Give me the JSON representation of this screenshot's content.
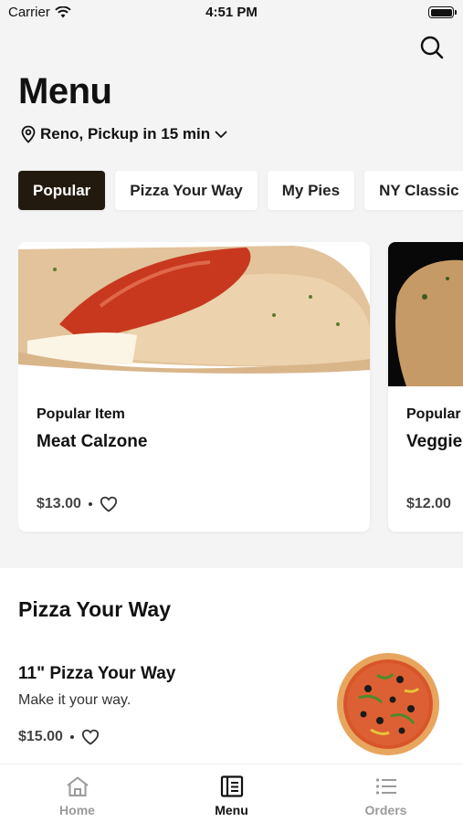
{
  "status_bar": {
    "carrier": "Carrier",
    "time": "4:51 PM"
  },
  "header": {
    "title": "Menu",
    "location": "Reno, Pickup in 15 min",
    "search_icon": "search-icon"
  },
  "categories": [
    {
      "label": "Popular",
      "active": true
    },
    {
      "label": "Pizza Your Way",
      "active": false
    },
    {
      "label": "My Pies",
      "active": false
    },
    {
      "label": "NY Classic",
      "active": false
    }
  ],
  "popular_items": [
    {
      "tag": "Popular Item",
      "name": "Meat Calzone",
      "price": "$13.00"
    },
    {
      "tag": "Popular",
      "name": "Veggie",
      "price": "$12.00"
    }
  ],
  "section": {
    "title": "Pizza Your Way",
    "item": {
      "name": "11\" Pizza Your Way",
      "description": "Make it your way.",
      "price": "$15.00"
    }
  },
  "tabbar": [
    {
      "label": "Home",
      "icon": "home-icon"
    },
    {
      "label": "Menu",
      "icon": "menu-book-icon"
    },
    {
      "label": "Orders",
      "icon": "list-icon"
    }
  ],
  "colors": {
    "accent": "#231a0f",
    "inactive": "#9a9a9a",
    "background": "#f4f4f4"
  }
}
